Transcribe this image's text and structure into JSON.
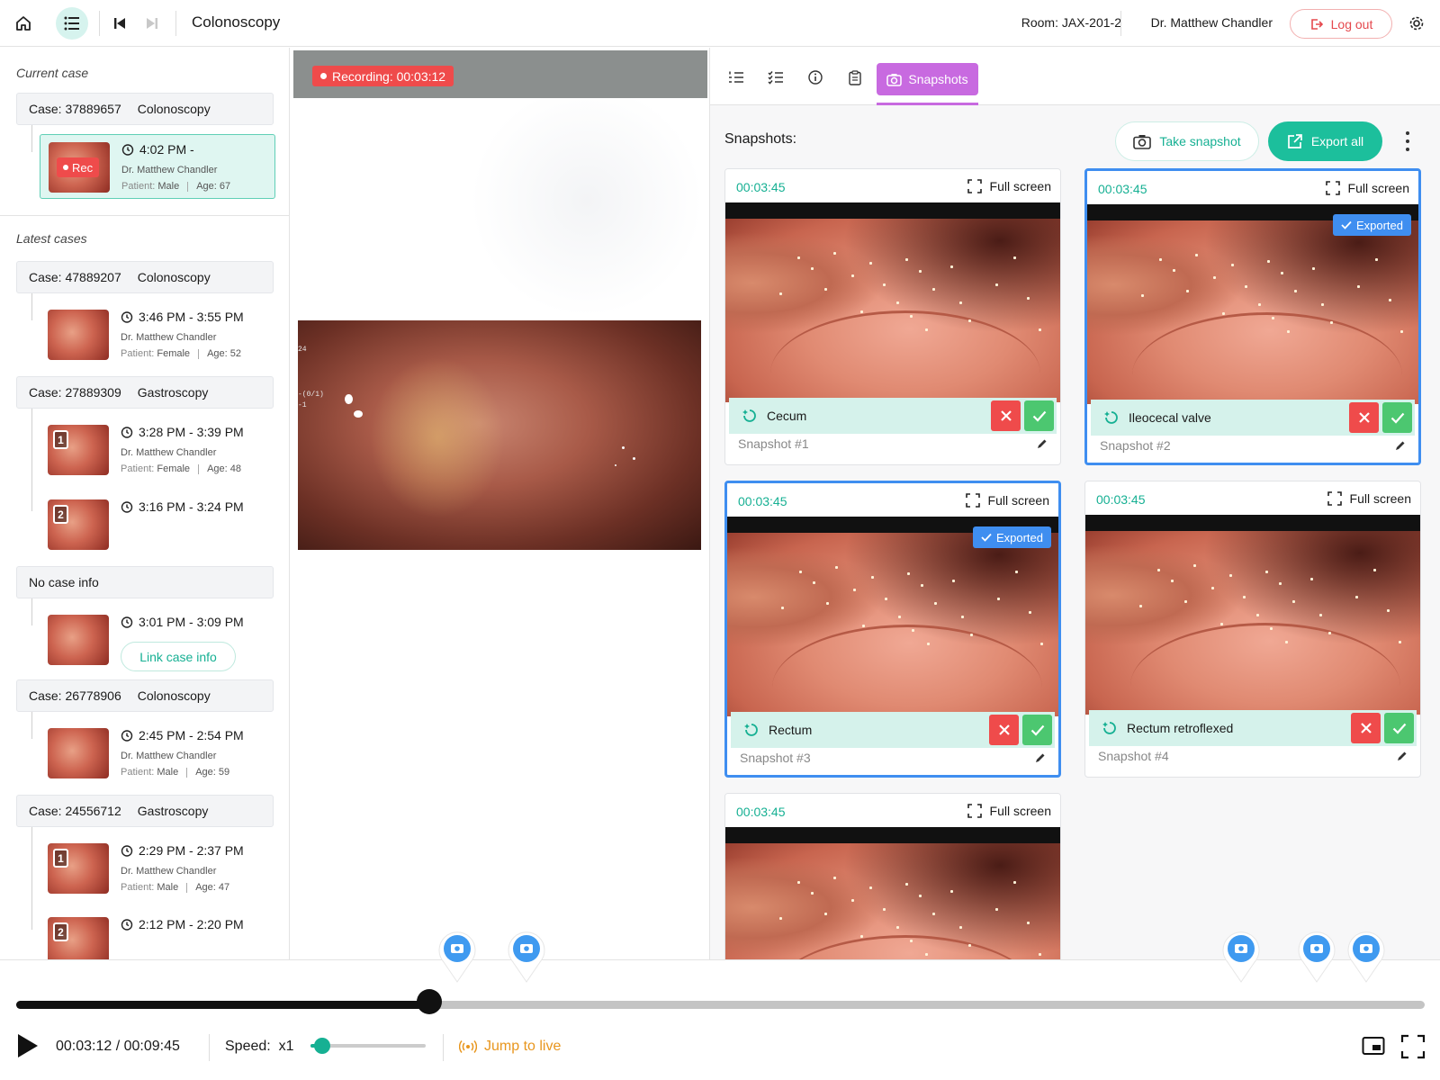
{
  "header": {
    "title": "Colonoscopy",
    "room": "Room: JAX-201-2",
    "doctor": "Dr. Matthew Chandler",
    "logout": "Log out"
  },
  "sidebar": {
    "current_label": "Current case",
    "latest_label": "Latest cases",
    "current": {
      "case_id": "Case: 37889657",
      "procedure": "Colonoscopy",
      "rec_label": "Rec",
      "time": "4:02 PM -",
      "doctor": "Dr. Matthew Chandler",
      "patient_label": "Patient:",
      "patient_sex": "Male",
      "age": "Age: 67"
    },
    "cases": [
      {
        "case_id": "Case: 47889207",
        "procedure": "Colonoscopy",
        "entries": [
          {
            "time": "3:46 PM - 3:55 PM",
            "doctor": "Dr. Matthew Chandler",
            "patient_label": "Patient:",
            "patient_sex": "Female",
            "age": "Age: 52"
          }
        ]
      },
      {
        "case_id": "Case: 27889309",
        "procedure": "Gastroscopy",
        "entries": [
          {
            "num": "1",
            "time": "3:28 PM - 3:39 PM",
            "doctor": "Dr. Matthew Chandler",
            "patient_label": "Patient:",
            "patient_sex": "Female",
            "age": "Age: 48"
          },
          {
            "num": "2",
            "time": "3:16 PM - 3:24 PM"
          }
        ]
      },
      {
        "case_id": "No case info",
        "procedure": "",
        "entries": [
          {
            "time": "3:01 PM - 3:09 PM",
            "link_label": "Link case info"
          }
        ]
      },
      {
        "case_id": "Case: 26778906",
        "procedure": "Colonoscopy",
        "entries": [
          {
            "time": "2:45 PM - 2:54 PM",
            "doctor": "Dr. Matthew Chandler",
            "patient_label": "Patient:",
            "patient_sex": "Male",
            "age": "Age: 59"
          }
        ]
      },
      {
        "case_id": "Case: 24556712",
        "procedure": "Gastroscopy",
        "entries": [
          {
            "num": "1",
            "time": "2:29 PM - 2:37 PM",
            "doctor": "Dr. Matthew Chandler",
            "patient_label": "Patient:",
            "patient_sex": "Male",
            "age": "Age: 47"
          },
          {
            "num": "2",
            "time": "2:12 PM - 2:20 PM"
          }
        ]
      }
    ]
  },
  "video": {
    "recording": "Recording: 00:03:12",
    "overlay_1": "24",
    "overlay_2": "-(0/1)",
    "overlay_3": "-1"
  },
  "snapshots_panel": {
    "tab_label": "Snapshots",
    "title": "Snapshots:",
    "take_label": "Take snapshot",
    "export_label": "Export all",
    "full_screen": "Full screen",
    "exported": "Exported",
    "cards": [
      {
        "time": "00:03:45",
        "label": "Cecum",
        "name": "Snapshot #1",
        "selected": false,
        "exported": false
      },
      {
        "time": "00:03:45",
        "label": "Ileocecal valve",
        "name": "Snapshot #2",
        "selected": true,
        "exported": true
      },
      {
        "time": "00:03:45",
        "label": "Rectum",
        "name": "Snapshot #3",
        "selected": true,
        "exported": true
      },
      {
        "time": "00:03:45",
        "label": "Rectum retroflexed",
        "name": "Snapshot #4",
        "selected": false,
        "exported": false
      },
      {
        "time": "00:03:45",
        "label": "",
        "name": "",
        "selected": false,
        "exported": false
      }
    ]
  },
  "player": {
    "timecode": "00:03:12 / 00:09:45",
    "speed_label": "Speed:",
    "speed_value": "x1",
    "jump_label": "Jump to live",
    "progress": 0.293
  },
  "colors": {
    "accent": "#16b093",
    "snapshot_tab": "#c86ae0",
    "selected_border": "#3f8ef0",
    "danger": "#ef4b4b",
    "confirm": "#4cc770",
    "jump": "#e8961e"
  }
}
